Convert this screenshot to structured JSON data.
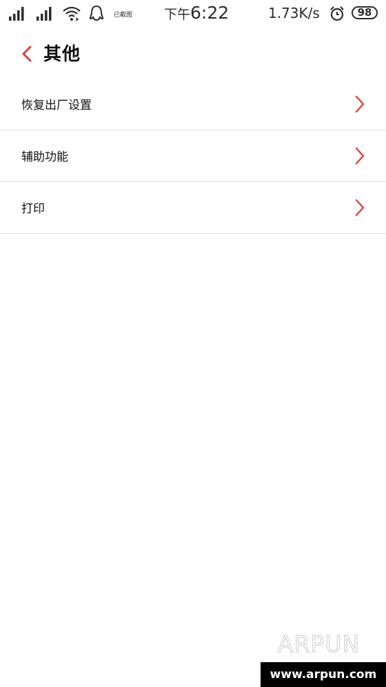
{
  "status_bar": {
    "dnd_text": "已截图",
    "time_ampm": "下午",
    "time": "6:22",
    "network_speed": "1.73K/s",
    "battery_level": "98",
    "icons": [
      "signal-icon",
      "signal-icon",
      "wifi-icon",
      "qq-icon",
      "alarm-icon",
      "battery-icon"
    ]
  },
  "header": {
    "title": "其他",
    "back_icon": "chevron-left-icon",
    "accent_color": "#e53c3c"
  },
  "settings": {
    "items": [
      {
        "label": "恢复出厂设置",
        "icon": "chevron-right-icon"
      },
      {
        "label": "辅助功能",
        "icon": "chevron-right-icon"
      },
      {
        "label": "打印",
        "icon": "chevron-right-icon"
      }
    ]
  },
  "watermark": {
    "logo": "ARPUN",
    "url": "www.arpun.com"
  }
}
